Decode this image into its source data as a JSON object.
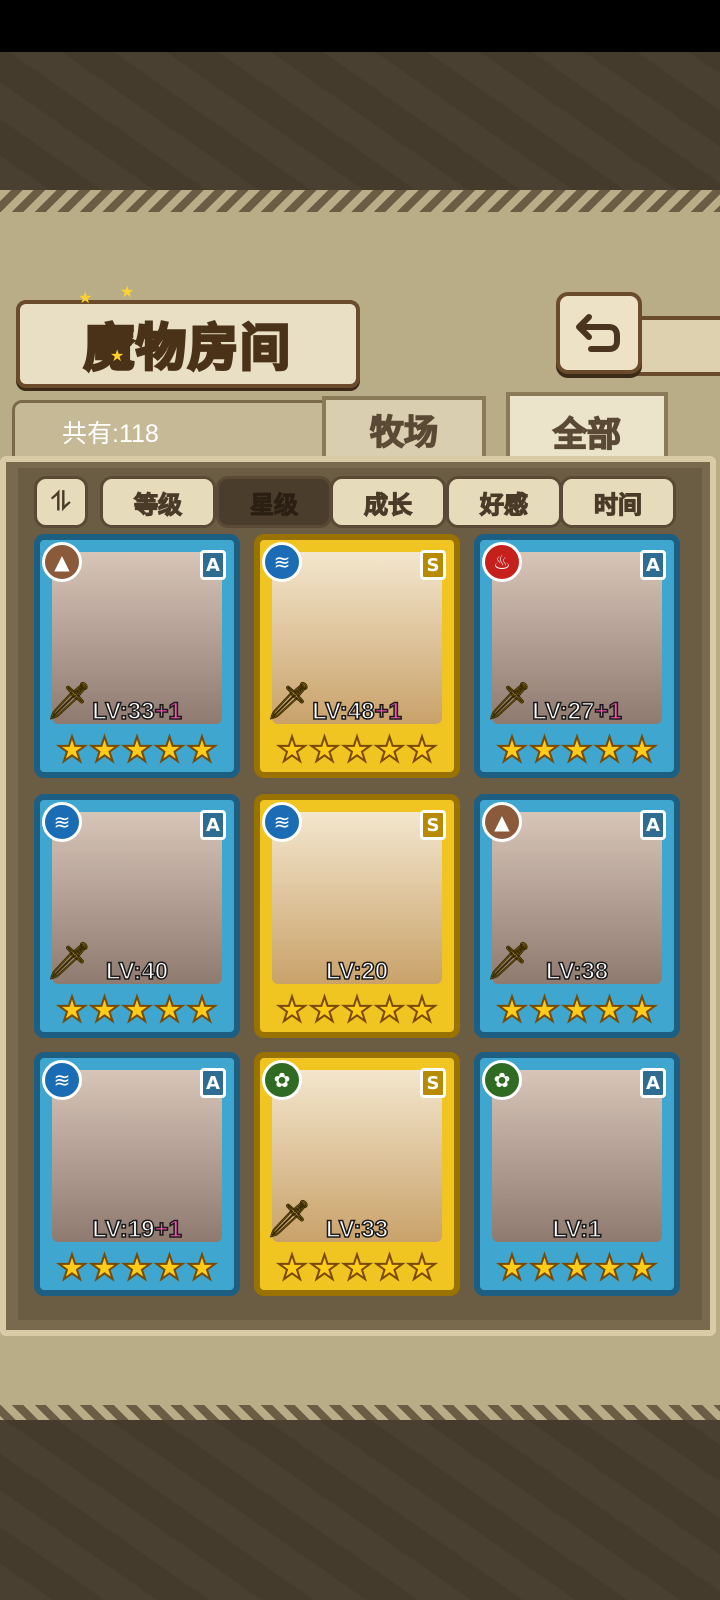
{
  "header": {
    "title": "魔物房间",
    "total_label": "共有:118"
  },
  "tabs": [
    {
      "label": "牧场",
      "active": false
    },
    {
      "label": "全部",
      "active": true
    }
  ],
  "sort": {
    "toggle_label": "⏸",
    "buttons": [
      {
        "label": "等级",
        "active": false
      },
      {
        "label": "星级",
        "active": true
      },
      {
        "label": "成长",
        "active": false
      },
      {
        "label": "好感",
        "active": false
      },
      {
        "label": "时间",
        "active": false
      }
    ]
  },
  "monsters": [
    {
      "level": "LV:33",
      "plus": "+1",
      "rank": "A",
      "element": "earth",
      "stars": 5,
      "sword": true
    },
    {
      "level": "LV:48",
      "plus": "+1",
      "rank": "S",
      "element": "water",
      "stars": 5,
      "sword": true
    },
    {
      "level": "LV:27",
      "plus": "+1",
      "rank": "A",
      "element": "fire",
      "stars": 5,
      "sword": true
    },
    {
      "level": "LV:40",
      "plus": "",
      "rank": "A",
      "element": "water",
      "stars": 5,
      "sword": true
    },
    {
      "level": "LV:20",
      "plus": "",
      "rank": "S",
      "element": "water",
      "stars": 5,
      "sword": false
    },
    {
      "level": "LV:38",
      "plus": "",
      "rank": "A",
      "element": "earth",
      "stars": 5,
      "sword": true
    },
    {
      "level": "LV:19",
      "plus": "+1",
      "rank": "A",
      "element": "water",
      "stars": 5,
      "sword": false
    },
    {
      "level": "LV:33",
      "plus": "",
      "rank": "S",
      "element": "wood",
      "stars": 5,
      "sword": true
    },
    {
      "level": "LV:1",
      "plus": "",
      "rank": "A",
      "element": "wood",
      "stars": 5,
      "sword": false
    }
  ],
  "colors": {
    "rank_a_frame": "#3fa6cf",
    "rank_s_frame": "#f0c522",
    "star": "#ffcc1a",
    "plus_text": "#ff4fb8"
  }
}
